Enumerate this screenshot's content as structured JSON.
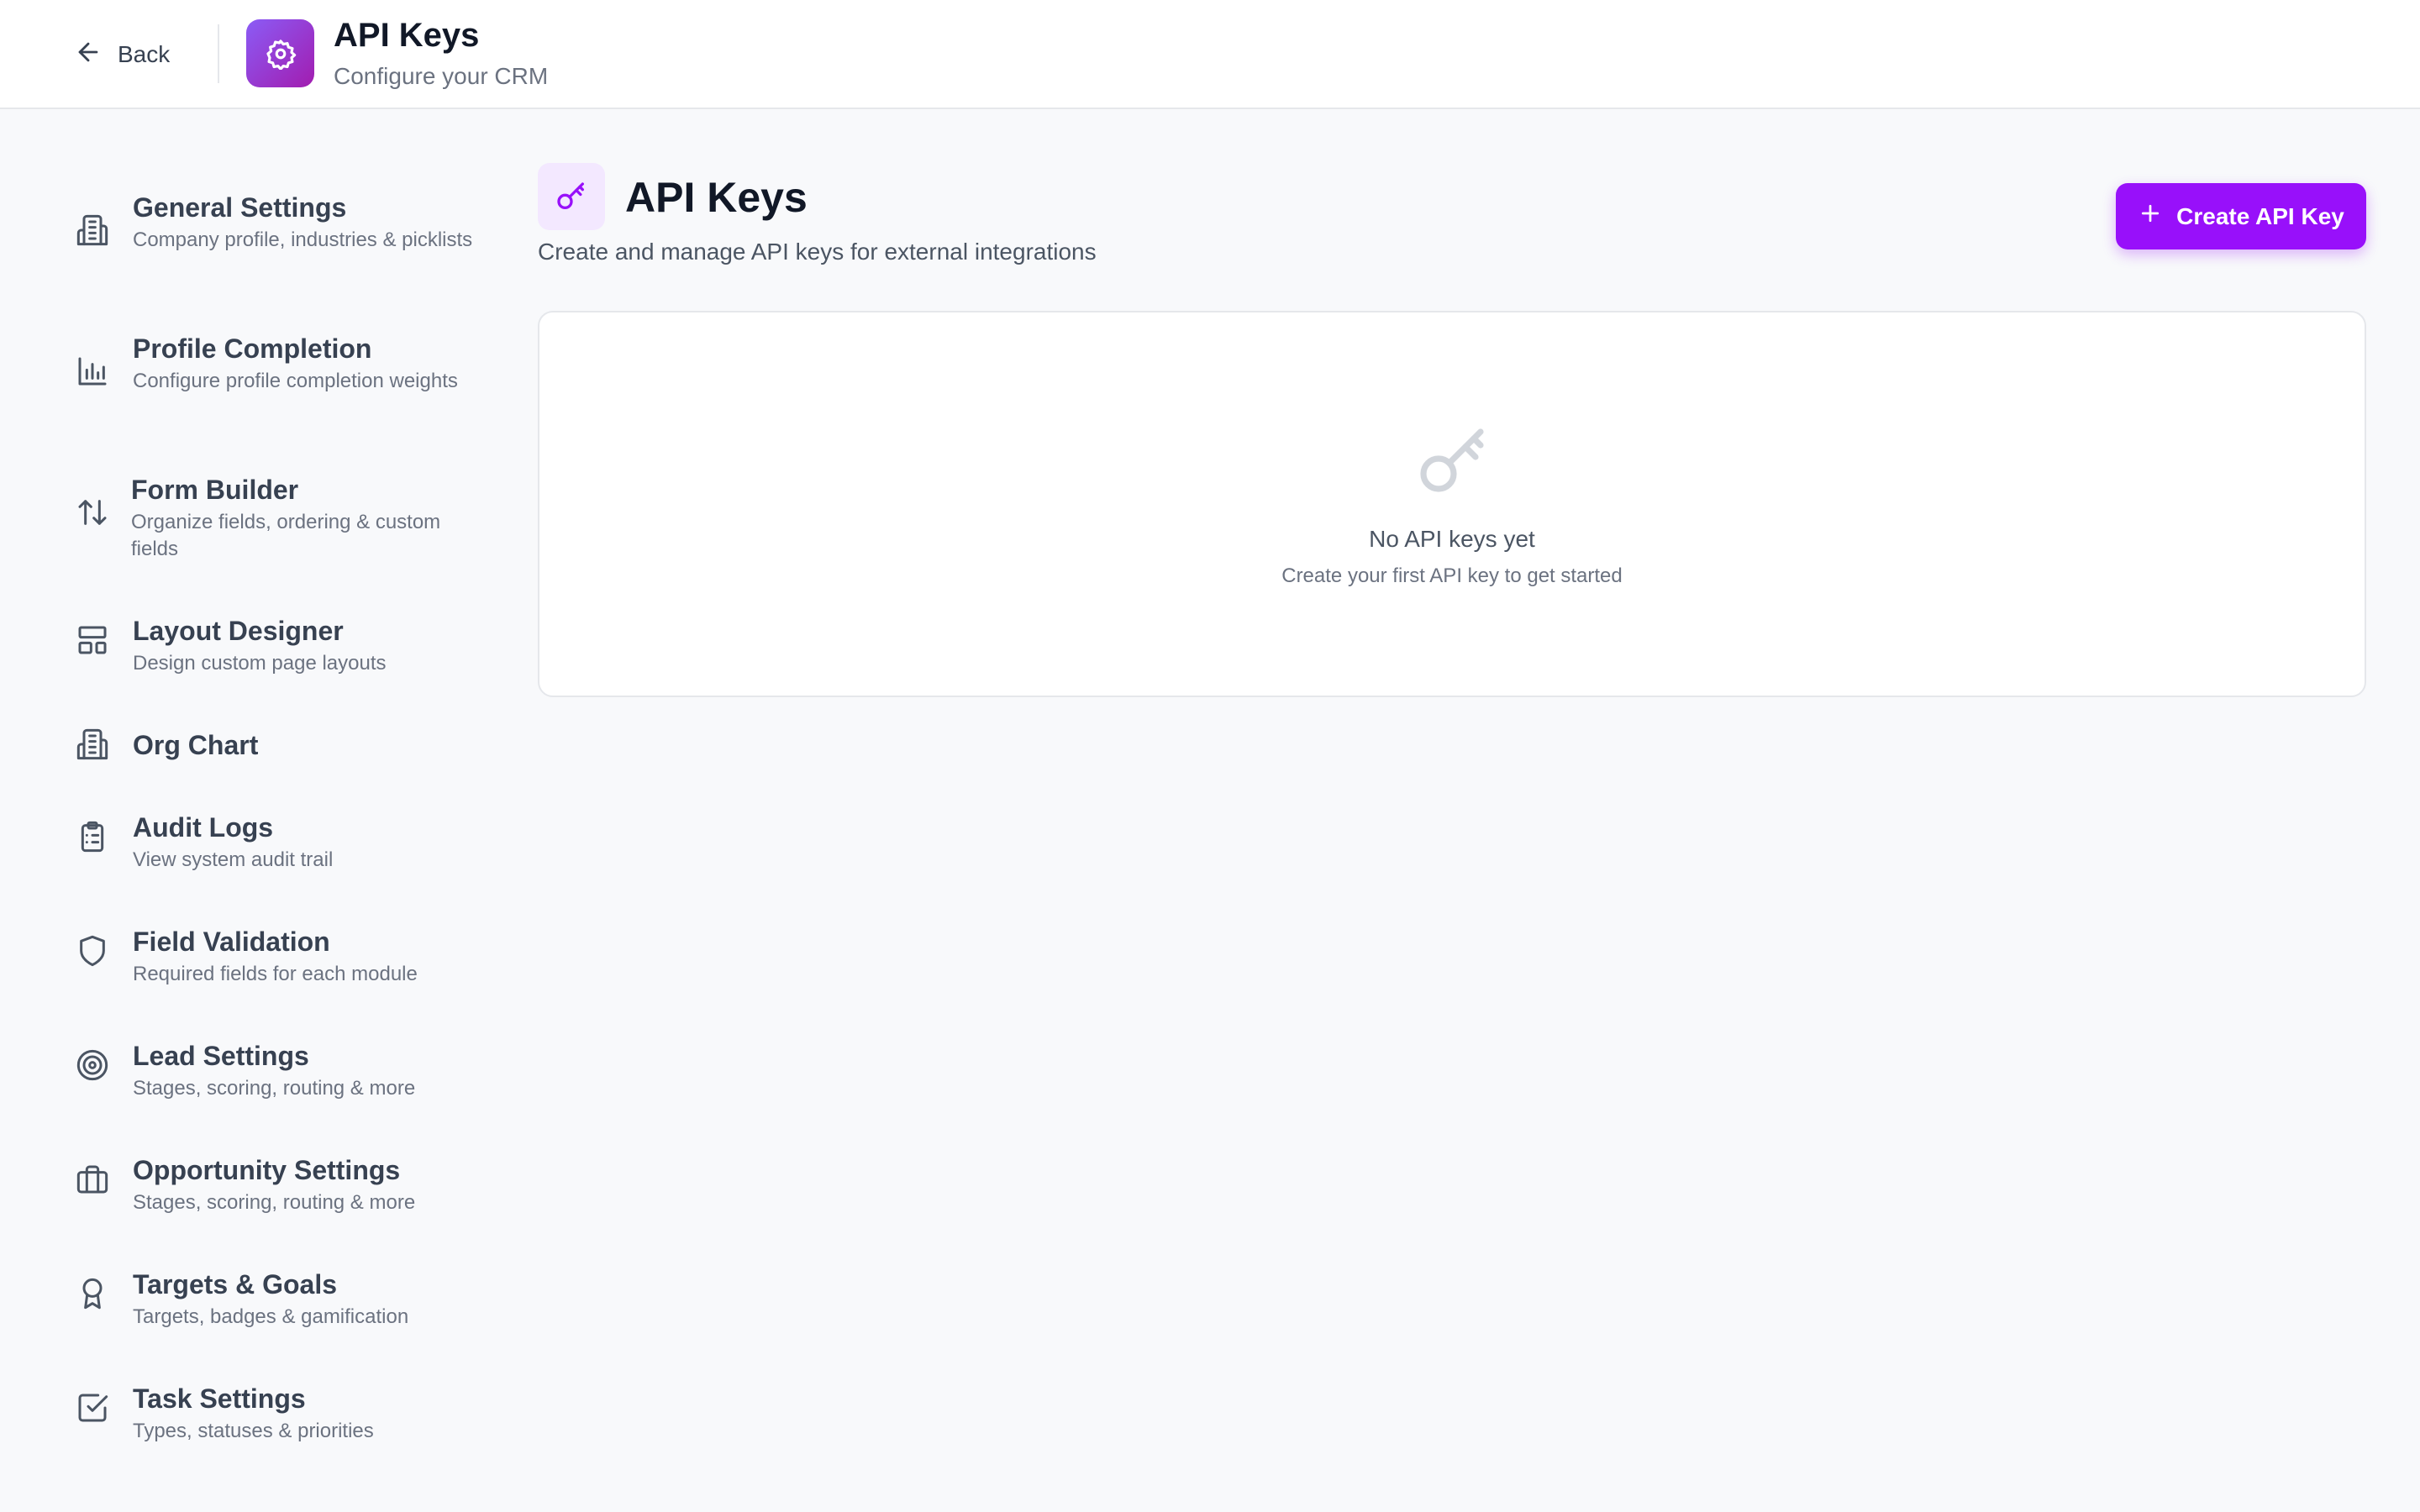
{
  "header": {
    "back_label": "Back",
    "title": "API Keys",
    "subtitle": "Configure your CRM"
  },
  "sidebar": {
    "items": [
      {
        "label": "General Settings",
        "desc": "Company profile, industries & picklists",
        "icon": "building-icon"
      },
      {
        "label": "Profile Completion",
        "desc": "Configure profile completion weights",
        "icon": "bar-chart-icon"
      },
      {
        "label": "Form Builder",
        "desc": "Organize fields, ordering & custom fields",
        "icon": "sort-arrows-icon"
      },
      {
        "label": "Layout Designer",
        "desc": "Design custom page layouts",
        "icon": "layout-icon"
      },
      {
        "label": "Org Chart",
        "desc": "",
        "icon": "building-icon"
      },
      {
        "label": "Audit Logs",
        "desc": "View system audit trail",
        "icon": "clipboard-list-icon"
      },
      {
        "label": "Field Validation",
        "desc": "Required fields for each module",
        "icon": "shield-icon"
      },
      {
        "label": "Lead Settings",
        "desc": "Stages, scoring, routing & more",
        "icon": "target-icon"
      },
      {
        "label": "Opportunity Settings",
        "desc": "Stages, scoring, routing & more",
        "icon": "briefcase-icon"
      },
      {
        "label": "Targets & Goals",
        "desc": "Targets, badges & gamification",
        "icon": "award-icon"
      },
      {
        "label": "Task Settings",
        "desc": "Types, statuses & priorities",
        "icon": "check-square-icon"
      }
    ]
  },
  "main": {
    "title": "API Keys",
    "subtitle": "Create and manage API keys for external integrations",
    "create_label": "Create API Key",
    "empty_title": "No API keys yet",
    "empty_subtitle": "Create your first API key to get started"
  },
  "colors": {
    "accent": "#9810fa",
    "icon_bg": "#f3e8ff",
    "page_bg": "#f8f9fb"
  }
}
